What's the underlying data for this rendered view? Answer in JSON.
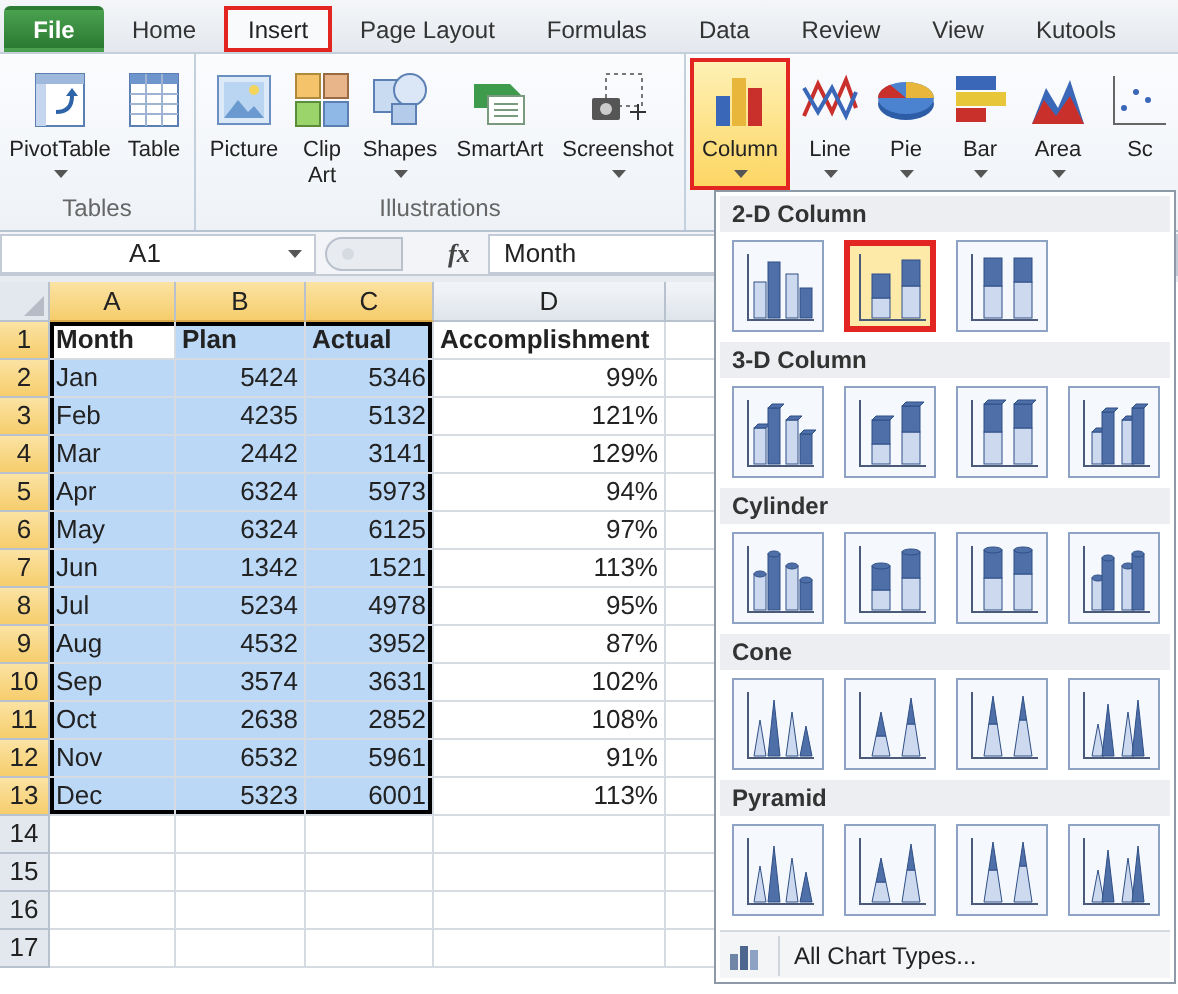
{
  "tabs": [
    {
      "label": "File",
      "kind": "file",
      "selected": false,
      "annotated": false
    },
    {
      "label": "Home",
      "kind": "tab",
      "selected": false,
      "annotated": false
    },
    {
      "label": "Insert",
      "kind": "tab",
      "selected": true,
      "annotated": true
    },
    {
      "label": "Page Layout",
      "kind": "tab",
      "selected": false,
      "annotated": false
    },
    {
      "label": "Formulas",
      "kind": "tab",
      "selected": false,
      "annotated": false
    },
    {
      "label": "Data",
      "kind": "tab",
      "selected": false,
      "annotated": false
    },
    {
      "label": "Review",
      "kind": "tab",
      "selected": false,
      "annotated": false
    },
    {
      "label": "View",
      "kind": "tab",
      "selected": false,
      "annotated": false
    },
    {
      "label": "Kutools",
      "kind": "tab",
      "selected": false,
      "annotated": false
    }
  ],
  "ribbon": {
    "groups": [
      {
        "label": "Tables",
        "buttons": [
          {
            "label": "PivotTable",
            "has_menu": true,
            "expanded": false,
            "annotated": false
          },
          {
            "label": "Table",
            "has_menu": false,
            "expanded": false,
            "annotated": false
          }
        ]
      },
      {
        "label": "Illustrations",
        "buttons": [
          {
            "label": "Picture",
            "has_menu": false,
            "expanded": false,
            "annotated": false
          },
          {
            "label": "Clip Art",
            "has_menu": false,
            "expanded": false,
            "annotated": false
          },
          {
            "label": "Shapes",
            "has_menu": true,
            "expanded": false,
            "annotated": false
          },
          {
            "label": "SmartArt",
            "has_menu": false,
            "expanded": false,
            "annotated": false
          },
          {
            "label": "Screenshot",
            "has_menu": true,
            "expanded": false,
            "annotated": false
          }
        ]
      },
      {
        "buttons": [
          {
            "label": "Column",
            "has_menu": true,
            "expanded": true,
            "annotated": true
          },
          {
            "label": "Line",
            "has_menu": true,
            "expanded": false,
            "annotated": false
          },
          {
            "label": "Pie",
            "has_menu": true,
            "expanded": false,
            "annotated": false
          },
          {
            "label": "Bar",
            "has_menu": true,
            "expanded": false,
            "annotated": false
          },
          {
            "label": "Area",
            "has_menu": true,
            "expanded": false,
            "annotated": false
          },
          {
            "label": "Sc",
            "has_menu": false,
            "expanded": false,
            "annotated": false
          }
        ]
      }
    ]
  },
  "formula_bar": {
    "name_box": "A1",
    "function_label": "fx",
    "formula": "Month"
  },
  "sheet": {
    "columns": [
      {
        "label": "A",
        "selected": true,
        "active": true,
        "numeric": false
      },
      {
        "label": "B",
        "selected": true,
        "active": false,
        "numeric": true
      },
      {
        "label": "C",
        "selected": true,
        "active": false,
        "numeric": true
      },
      {
        "label": "D",
        "selected": false,
        "active": false,
        "numeric": true
      },
      {
        "selected": false,
        "active": false
      }
    ],
    "rows": [
      {
        "number": "1",
        "kind": "header",
        "selected": true,
        "active": true,
        "cells": [
          "Month",
          "Plan",
          "Actual",
          "Accomplishment"
        ]
      },
      {
        "number": "2",
        "kind": "data",
        "selected": true,
        "active": false,
        "cells": [
          "Jan",
          "5424",
          "5346",
          "99%"
        ]
      },
      {
        "number": "3",
        "kind": "data",
        "selected": true,
        "active": false,
        "cells": [
          "Feb",
          "4235",
          "5132",
          "121%"
        ]
      },
      {
        "number": "4",
        "kind": "data",
        "selected": true,
        "active": false,
        "cells": [
          "Mar",
          "2442",
          "3141",
          "129%"
        ]
      },
      {
        "number": "5",
        "kind": "data",
        "selected": true,
        "active": false,
        "cells": [
          "Apr",
          "6324",
          "5973",
          "94%"
        ]
      },
      {
        "number": "6",
        "kind": "data",
        "selected": true,
        "active": false,
        "cells": [
          "May",
          "6324",
          "6125",
          "97%"
        ]
      },
      {
        "number": "7",
        "kind": "data",
        "selected": true,
        "active": false,
        "cells": [
          "Jun",
          "1342",
          "1521",
          "113%"
        ]
      },
      {
        "number": "8",
        "kind": "data",
        "selected": true,
        "active": false,
        "cells": [
          "Jul",
          "5234",
          "4978",
          "95%"
        ]
      },
      {
        "number": "9",
        "kind": "data",
        "selected": true,
        "active": false,
        "cells": [
          "Aug",
          "4532",
          "3952",
          "87%"
        ]
      },
      {
        "number": "10",
        "kind": "data",
        "selected": true,
        "active": false,
        "cells": [
          "Sep",
          "3574",
          "3631",
          "102%"
        ]
      },
      {
        "number": "11",
        "kind": "data",
        "selected": true,
        "active": false,
        "cells": [
          "Oct",
          "2638",
          "2852",
          "108%"
        ]
      },
      {
        "number": "12",
        "kind": "data",
        "selected": true,
        "active": false,
        "cells": [
          "Nov",
          "6532",
          "5961",
          "91%"
        ]
      },
      {
        "number": "13",
        "kind": "data",
        "selected": true,
        "active": false,
        "cells": [
          "Dec",
          "5323",
          "6001",
          "113%"
        ]
      },
      {
        "number": "14",
        "kind": "data",
        "selected": false,
        "active": false,
        "cells": []
      },
      {
        "number": "15",
        "kind": "data",
        "selected": false,
        "active": false,
        "cells": []
      },
      {
        "number": "16",
        "kind": "data",
        "selected": false,
        "active": false,
        "cells": []
      },
      {
        "number": "17",
        "kind": "data",
        "selected": false,
        "active": false,
        "cells": []
      }
    ]
  },
  "chart_menu": {
    "sections": [
      {
        "title": "2-D Column",
        "kind": "column2d",
        "options": [
          {
            "highlighted": false,
            "annotated": false
          },
          {
            "highlighted": true,
            "annotated": true
          },
          {
            "highlighted": false,
            "annotated": false
          }
        ]
      },
      {
        "title": "3-D Column",
        "kind": "column3d",
        "options": [
          {
            "highlighted": false,
            "annotated": false
          },
          {
            "highlighted": false,
            "annotated": false
          },
          {
            "highlighted": false,
            "annotated": false
          },
          {
            "highlighted": false,
            "annotated": false
          }
        ]
      },
      {
        "title": "Cylinder",
        "kind": "cylinder",
        "options": [
          {
            "highlighted": false,
            "annotated": false
          },
          {
            "highlighted": false,
            "annotated": false
          },
          {
            "highlighted": false,
            "annotated": false
          },
          {
            "highlighted": false,
            "annotated": false
          }
        ]
      },
      {
        "title": "Cone",
        "kind": "cone",
        "options": [
          {
            "highlighted": false,
            "annotated": false
          },
          {
            "highlighted": false,
            "annotated": false
          },
          {
            "highlighted": false,
            "annotated": false
          },
          {
            "highlighted": false,
            "annotated": false
          }
        ]
      },
      {
        "title": "Pyramid",
        "kind": "pyramid",
        "options": [
          {
            "highlighted": false,
            "annotated": false
          },
          {
            "highlighted": false,
            "annotated": false
          },
          {
            "highlighted": false,
            "annotated": false
          },
          {
            "highlighted": false,
            "annotated": false
          }
        ]
      }
    ],
    "footer": "All Chart Types..."
  }
}
